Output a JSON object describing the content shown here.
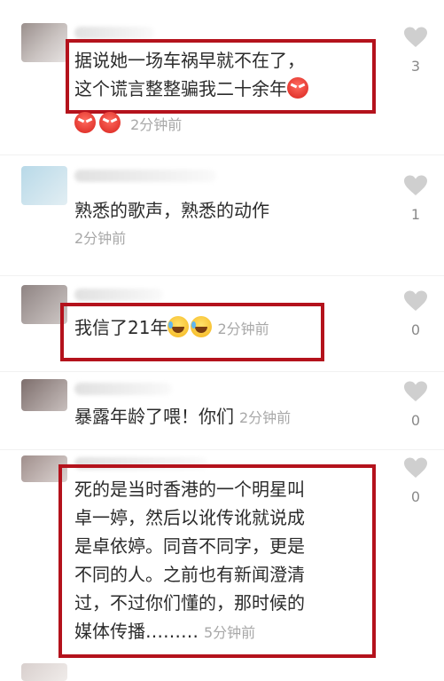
{
  "comments": [
    {
      "lines": [
        "据说她一场车祸早就不在了，",
        "这个谎言整整骗我二十余年"
      ],
      "time": "2分钟前",
      "likes": "3"
    },
    {
      "lines": [
        "熟悉的歌声，熟悉的动作"
      ],
      "time": "2分钟前",
      "likes": "1"
    },
    {
      "lines": [
        "我信了21年"
      ],
      "time": "2分钟前",
      "likes": "0"
    },
    {
      "lines": [
        "暴露年龄了喂！你们"
      ],
      "time": "2分钟前",
      "likes": "0"
    },
    {
      "lines": [
        "死的是当时香港的一个明星叫",
        "卓一婷，然后以讹传讹就说成",
        "是卓依婷。同音不同字，更是",
        "不同的人。之前也有新闻澄清",
        "过，不过你们懂的，那时候的",
        "媒体传播………"
      ],
      "time": "5分钟前",
      "likes": "0"
    }
  ],
  "icons": {
    "like": "heart-icon",
    "angry": "angry-face-emoji",
    "laugh": "laughing-crying-emoji"
  },
  "colors": {
    "highlight_box": "#b4121c",
    "meta_text": "#a8a8a8"
  }
}
